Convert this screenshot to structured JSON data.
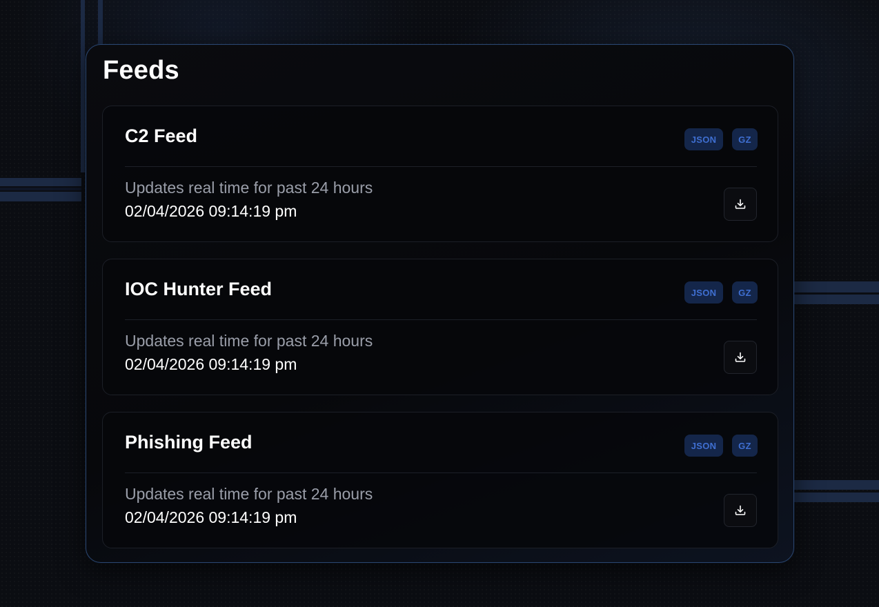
{
  "panel": {
    "title": "Feeds"
  },
  "feeds": [
    {
      "name": "C2 Feed",
      "formats": [
        "JSON",
        "GZ"
      ],
      "description": "Updates real time for past 24 hours",
      "updated": "02/04/2026 09:14:19 pm",
      "action_icon": "download-icon"
    },
    {
      "name": "IOC Hunter Feed",
      "formats": [
        "JSON",
        "GZ"
      ],
      "description": "Updates real time for past 24 hours",
      "updated": "02/04/2026 09:14:19 pm",
      "action_icon": "download-icon"
    },
    {
      "name": "Phishing Feed",
      "formats": [
        "JSON",
        "GZ"
      ],
      "description": "Updates real time for past 24 hours",
      "updated": "02/04/2026 09:14:19 pm",
      "action_icon": "download-icon"
    }
  ],
  "colors": {
    "panel_border": "#2a4670",
    "tag_background": "#14264a",
    "tag_text": "#3f6fd1",
    "muted_text": "#9a9ea9"
  }
}
